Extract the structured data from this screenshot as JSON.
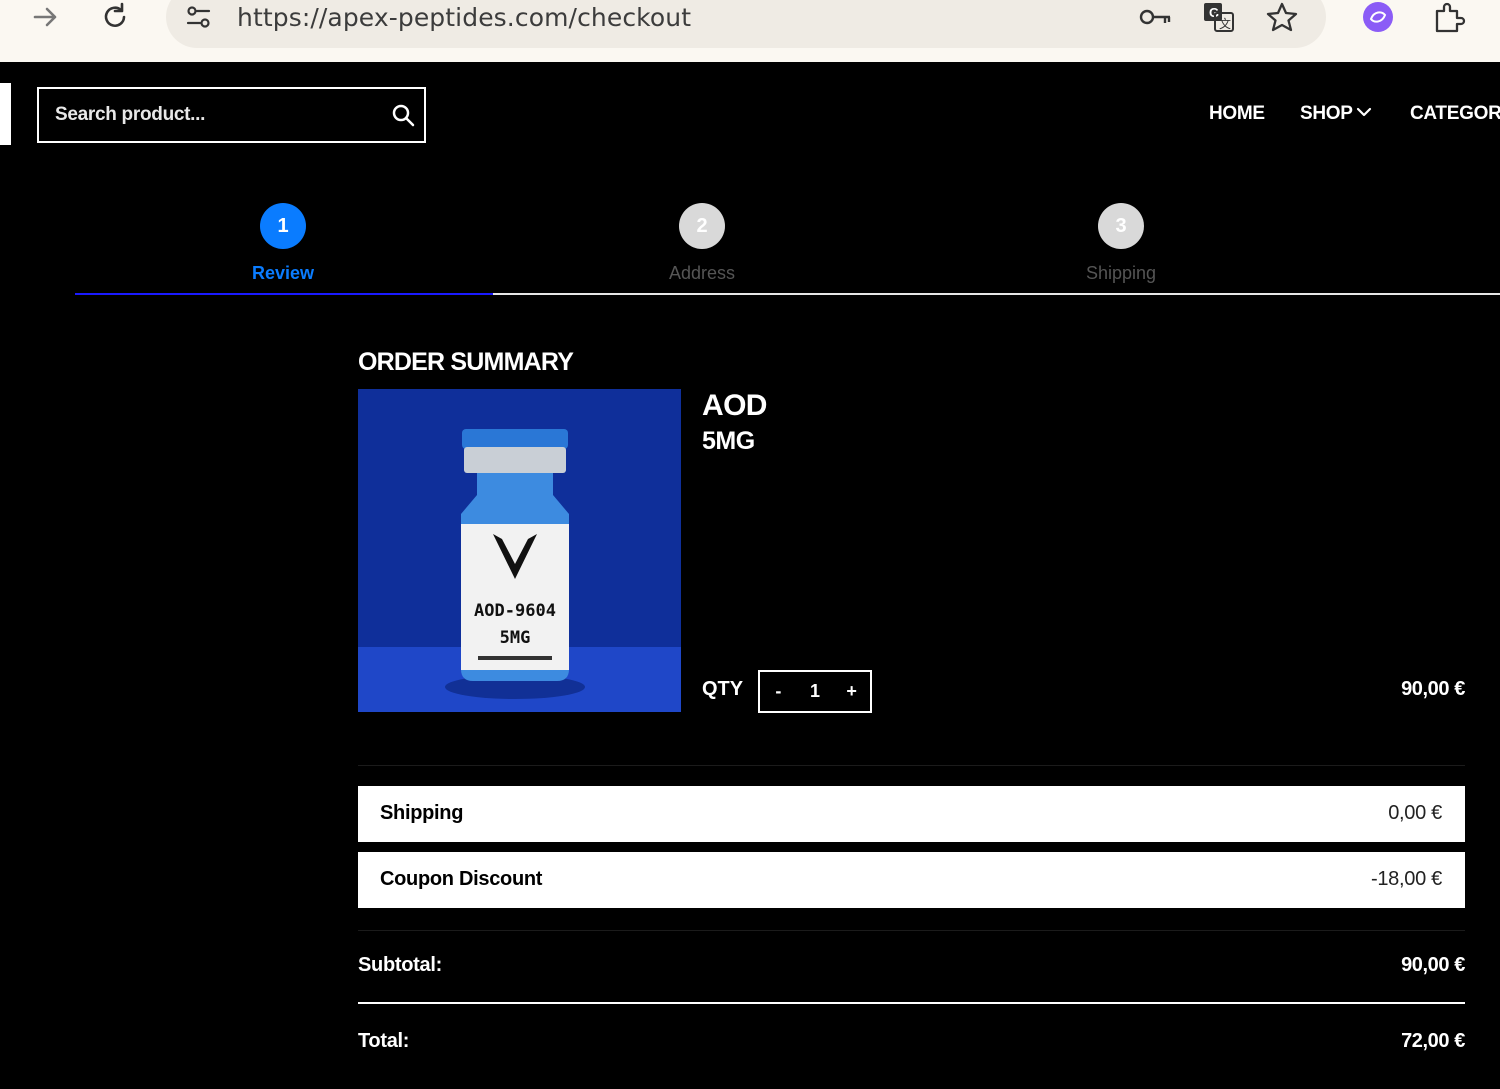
{
  "browser": {
    "url": "https://apex-peptides.com/checkout",
    "icons": [
      "forward-arrow-icon",
      "reload-icon",
      "site-settings-icon",
      "password-key-icon",
      "translate-icon",
      "bookmark-star-icon",
      "copilot-icon",
      "extensions-icon"
    ]
  },
  "header": {
    "search_placeholder": "Search product...",
    "nav": [
      {
        "label": "HOME"
      },
      {
        "label": "SHOP"
      },
      {
        "label": "CATEGORI"
      }
    ]
  },
  "steps": [
    {
      "number": "1",
      "label": "Review",
      "active": true
    },
    {
      "number": "2",
      "label": "Address",
      "active": false
    },
    {
      "number": "3",
      "label": "Shipping",
      "active": false
    }
  ],
  "summary": {
    "heading": "ORDER SUMMARY",
    "product": {
      "name": "AOD",
      "variant": "5MG",
      "qty_label": "QTY",
      "qty_minus": "-",
      "qty": "1",
      "qty_plus": "+",
      "price": "90,00 €",
      "image_text_line1": "AOD-9604",
      "image_text_line2": "5MG"
    },
    "shipping": {
      "label": "Shipping",
      "value": "0,00 €"
    },
    "coupon": {
      "label": "Coupon Discount",
      "value": "-18,00 €"
    },
    "subtotal": {
      "label": "Subtotal:",
      "value": "90,00 €"
    },
    "total": {
      "label": "Total:",
      "value": "72,00 €"
    }
  },
  "colors": {
    "accent": "#0a7cff",
    "step_inactive": "#d9d9d9",
    "product_bg": "#0f2f9a",
    "active_line": "#1a1aff"
  }
}
